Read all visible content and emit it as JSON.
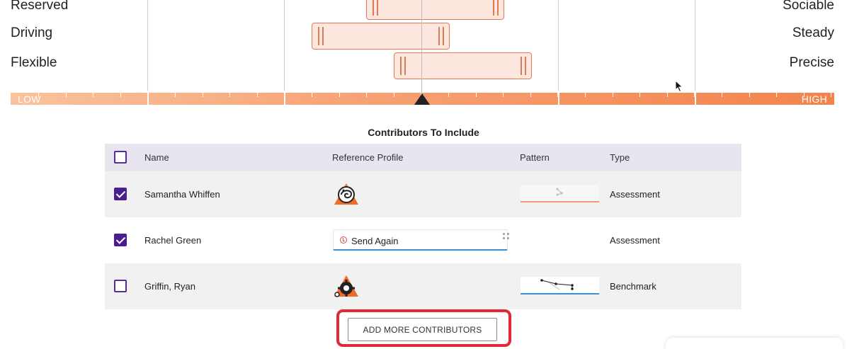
{
  "chart": {
    "factors": [
      {
        "left": "Reserved",
        "right": "Sociable"
      },
      {
        "left": "Driving",
        "right": "Steady"
      },
      {
        "left": "Flexible",
        "right": "Precise"
      }
    ],
    "scale_low": "LOW",
    "scale_high": "HIGH",
    "colors": {
      "bar_fill": "#fde7df",
      "bar_stroke": "#e07a55",
      "scale_start": "#f9c39d",
      "scale_end": "#f3834d"
    }
  },
  "contributors": {
    "title": "Contributors To Include",
    "columns": {
      "name": "Name",
      "reference": "Reference Profile",
      "pattern": "Pattern",
      "type": "Type"
    },
    "rows": [
      {
        "name": "Samantha Whiffen",
        "type": "Assessment",
        "checked": true,
        "reference_icon": "chameleon-profile-icon"
      },
      {
        "name": "Rachel Green",
        "type": "Assessment",
        "checked": true,
        "status": "Send Again"
      },
      {
        "name": "Griffin, Ryan",
        "type": "Benchmark",
        "checked": false,
        "reference_icon": "gear-profile-icon"
      }
    ],
    "add_button": "ADD MORE CONTRIBUTORS"
  },
  "colors": {
    "accent": "#4b1d8f",
    "highlight": "#e02a3a",
    "header_bg": "#e9e5ef"
  }
}
